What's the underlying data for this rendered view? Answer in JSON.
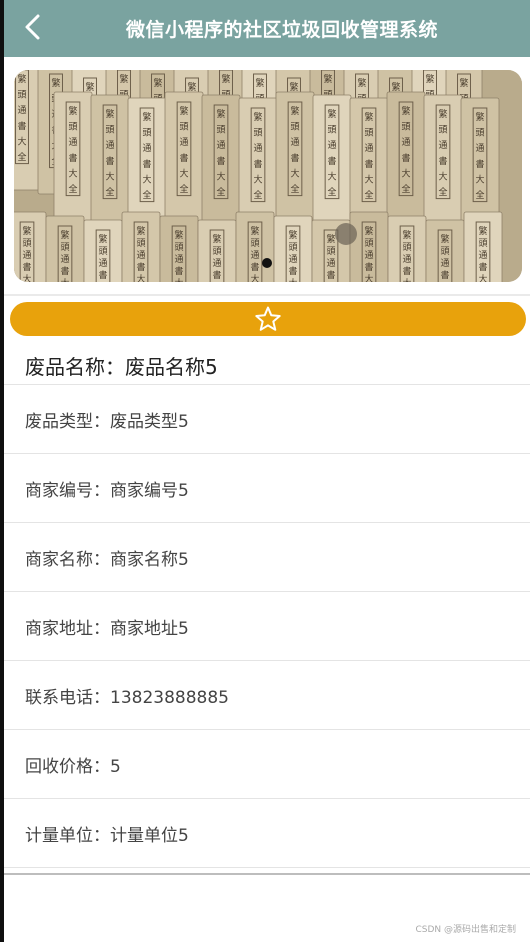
{
  "header": {
    "title": "微信小程序的社区垃圾回收管理系统",
    "back_icon": "chevron-left-icon",
    "background": "#7aa3a0"
  },
  "banner": {
    "slide_indicator": "dot",
    "book_label_chars": [
      "繁",
      "頭",
      "通",
      "書",
      "大",
      "全"
    ]
  },
  "favorite": {
    "icon": "star-outline-icon",
    "background": "#e8a20c"
  },
  "item": {
    "name_label": "废品名称：",
    "name_value": "废品名称5"
  },
  "fields": [
    {
      "label": "废品类型：",
      "value": "废品类型5"
    },
    {
      "label": "商家编号：",
      "value": "商家编号5"
    },
    {
      "label": "商家名称：",
      "value": "商家名称5"
    },
    {
      "label": "商家地址：",
      "value": "商家地址5"
    },
    {
      "label": "联系电话：",
      "value": "13823888885"
    },
    {
      "label": "回收价格：",
      "value": "5"
    },
    {
      "label": "计量单位：",
      "value": "计量单位5"
    }
  ],
  "watermark": "CSDN @源码出售和定制"
}
